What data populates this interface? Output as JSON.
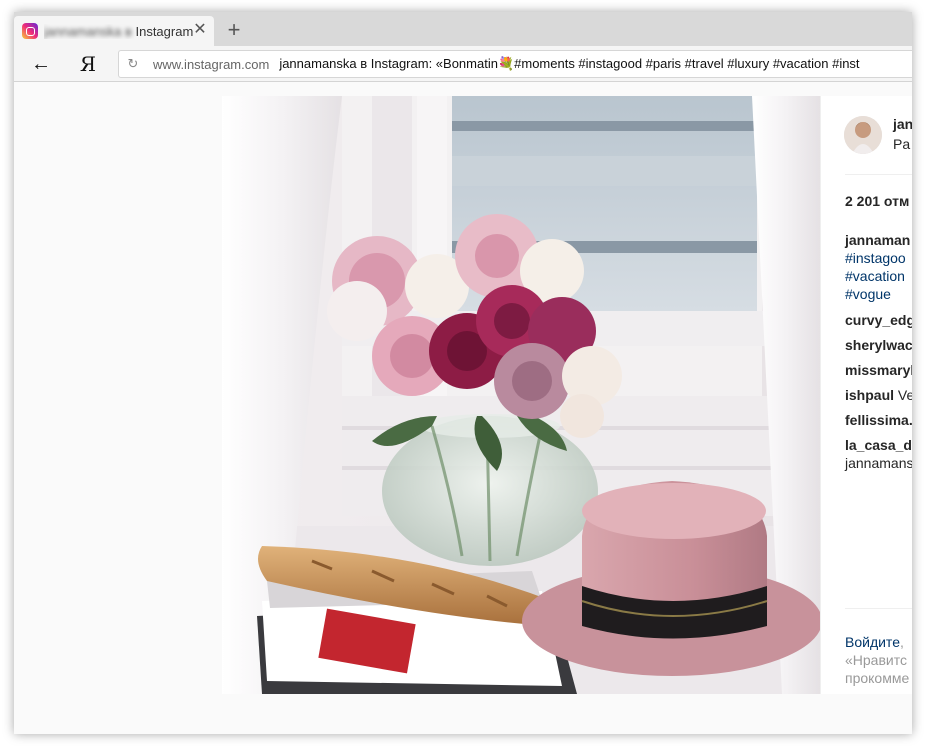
{
  "browser": {
    "tab": {
      "title_blurred": "jannamanska в",
      "title_suffix": " Instagram",
      "favicon": "instagram-icon"
    },
    "new_tab_symbol": "+",
    "close_symbol": "✕",
    "back_symbol": "←",
    "yandex_symbol": "Я",
    "reload_symbol": "↻",
    "address": {
      "domain": "www.instagram.com",
      "page_title": "jannamanska в Instagram: «Bonmatin💐#moments #instagood #paris #travel #luxury #vacation #inst"
    }
  },
  "post": {
    "author": {
      "name": "jan",
      "location": "Pa"
    },
    "likes": "2 201 отм",
    "caption": {
      "username": "jannaman",
      "hashtags": [
        "#instagoo",
        "#vacation",
        "#vogue"
      ]
    },
    "comments": [
      {
        "user": "curvy_edg",
        "text": ""
      },
      {
        "user": "sherylwac",
        "text": ""
      },
      {
        "user": "missmaryl",
        "text": ""
      },
      {
        "user": "ishpaul",
        "text": " Ve"
      },
      {
        "user": "fellissima.",
        "text": ""
      },
      {
        "user": "la_casa_d",
        "text": ""
      }
    ],
    "reply_line": "jannamans",
    "login_prompt": {
      "link": "Войдите",
      "rest": ", ",
      "line2": "«Нравитс",
      "line3": "прокомме"
    }
  },
  "colors": {
    "instagram_link": "#003569",
    "text": "#262626",
    "muted": "#999999"
  }
}
